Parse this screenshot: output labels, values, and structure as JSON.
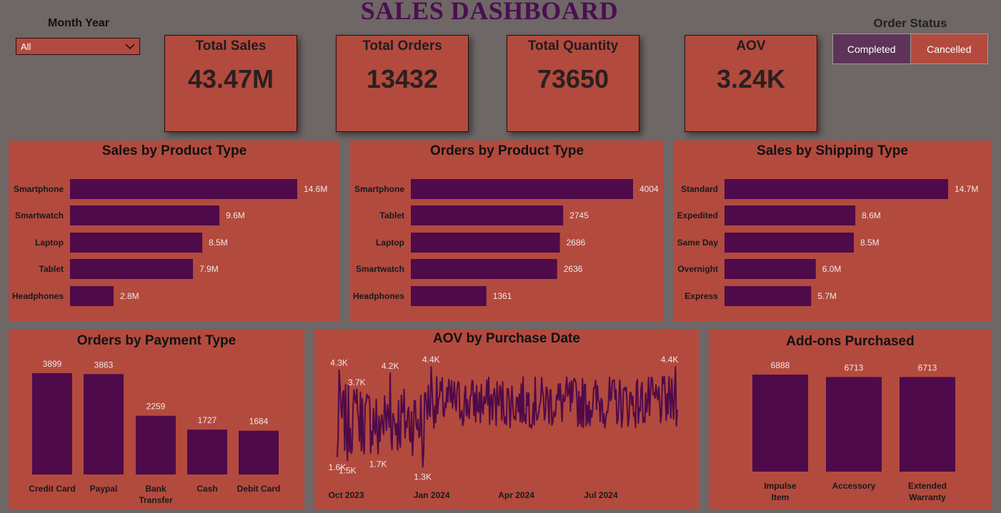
{
  "header": {
    "title": "SALES DASHBOARD"
  },
  "filters": {
    "month_year": {
      "label": "Month Year",
      "value": "All"
    },
    "order_status": {
      "label": "Order Status",
      "options": [
        "Completed",
        "Cancelled"
      ],
      "selected": "Completed"
    }
  },
  "kpis": [
    {
      "label": "Total Sales",
      "value": "43.47M"
    },
    {
      "label": "Total Orders",
      "value": "13432"
    },
    {
      "label": "Total Quantity",
      "value": "73650"
    },
    {
      "label": "AOV",
      "value": "3.24K"
    }
  ],
  "colors": {
    "background": "#6f6666",
    "panel": "#b34a3e",
    "bar": "#4f0a4a",
    "title": "#4a0f50",
    "selected": "#5e3359"
  },
  "chart_data": [
    {
      "type": "bar",
      "orientation": "horizontal",
      "title": "Sales by Product Type",
      "categories": [
        "Smartphone",
        "Smartwatch",
        "Laptop",
        "Tablet",
        "Headphones"
      ],
      "values": [
        14.6,
        9.6,
        8.5,
        7.9,
        2.8
      ],
      "value_labels": [
        "14.6M",
        "9.6M",
        "8.5M",
        "7.9M",
        "2.8M"
      ],
      "unit": "M"
    },
    {
      "type": "bar",
      "orientation": "horizontal",
      "title": "Orders by Product Type",
      "categories": [
        "Smartphone",
        "Tablet",
        "Laptop",
        "Smartwatch",
        "Headphones"
      ],
      "values": [
        4004,
        2745,
        2686,
        2636,
        1361
      ],
      "value_labels": [
        "4004",
        "2745",
        "2686",
        "2636",
        "1361"
      ]
    },
    {
      "type": "bar",
      "orientation": "horizontal",
      "title": "Sales by Shipping Type",
      "categories": [
        "Standard",
        "Expedited",
        "Same Day",
        "Overnight",
        "Express"
      ],
      "values": [
        14.7,
        8.6,
        8.5,
        6.0,
        5.7
      ],
      "value_labels": [
        "14.7M",
        "8.6M",
        "8.5M",
        "6.0M",
        "5.7M"
      ],
      "unit": "M"
    },
    {
      "type": "bar",
      "orientation": "vertical",
      "title": "Orders by Payment Type",
      "categories": [
        "Credit Card",
        "Paypal",
        "Bank Transfer",
        "Cash",
        "Debit Card"
      ],
      "values": [
        3899,
        3863,
        2259,
        1727,
        1684
      ],
      "value_labels": [
        "3899",
        "3863",
        "2259",
        "1727",
        "1684"
      ]
    },
    {
      "type": "line",
      "title": "AOV by Purchase Date",
      "x_ticks": [
        "Oct 2023",
        "Jan 2024",
        "Apr 2024",
        "Jul 2024"
      ],
      "ylim": [
        1.0,
        4.6
      ],
      "y_unit": "K",
      "annotations": [
        {
          "x": "2023-09-29",
          "label": "1.6K",
          "value": 1.6
        },
        {
          "x": "2023-10-01",
          "label": "4.3K",
          "value": 4.3
        },
        {
          "x": "2023-10-10",
          "label": "1.5K",
          "value": 1.5
        },
        {
          "x": "2023-10-20",
          "label": "3.7K",
          "value": 3.7
        },
        {
          "x": "2023-11-12",
          "label": "1.7K",
          "value": 1.7
        },
        {
          "x": "2023-11-25",
          "label": "4.2K",
          "value": 4.2
        },
        {
          "x": "2023-12-30",
          "label": "1.3K",
          "value": 1.3
        },
        {
          "x": "2024-01-08",
          "label": "4.4K",
          "value": 4.4
        },
        {
          "x": "2024-09-27",
          "label": "4.4K",
          "value": 4.4
        }
      ]
    },
    {
      "type": "bar",
      "orientation": "vertical",
      "title": "Add-ons Purchased",
      "categories": [
        "Impulse Item",
        "Accessory",
        "Extended Warranty"
      ],
      "values": [
        6888,
        6713,
        6713
      ],
      "value_labels": [
        "6888",
        "6713",
        "6713"
      ]
    }
  ]
}
